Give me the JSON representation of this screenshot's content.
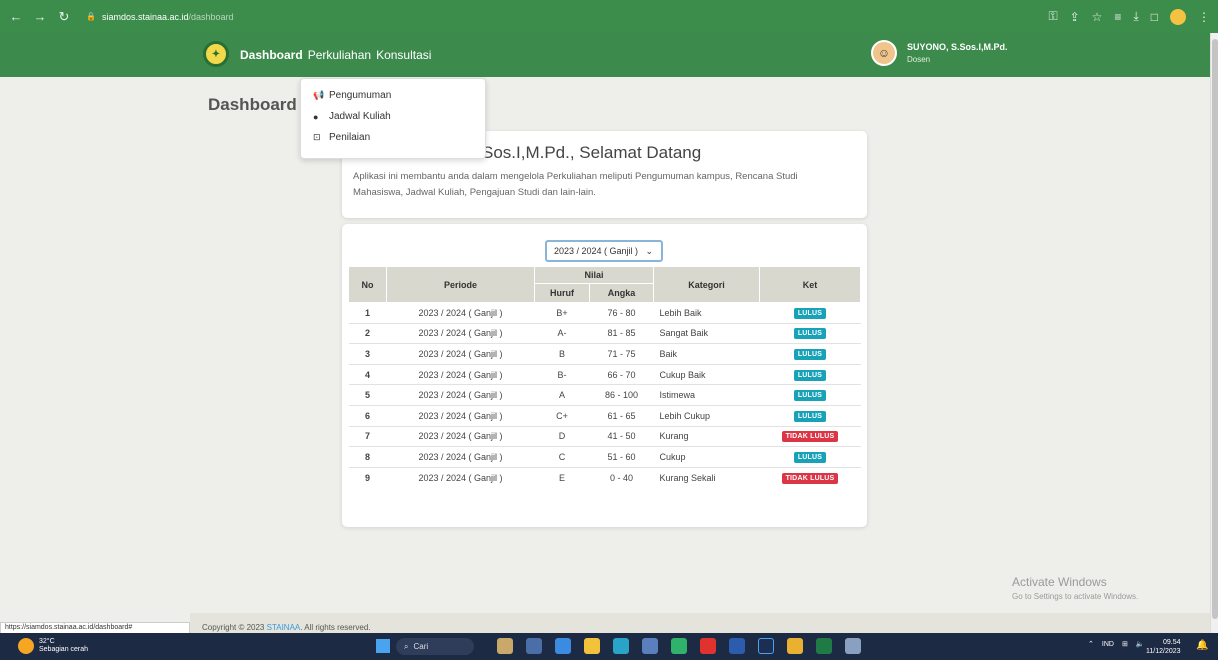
{
  "browser": {
    "url_host": "siamdos.stainaa.ac.id",
    "url_path": "/dashboard"
  },
  "nav": {
    "items": [
      "Dashboard",
      "Perkuliahan",
      "Konsultasi"
    ],
    "user_name": "SUYONO, S.Sos.I,M.Pd.",
    "user_role": "Dosen"
  },
  "page_title": "Dashboard",
  "dropdown": {
    "items": [
      "Pengumuman",
      "Jadwal Kuliah",
      "Penilaian"
    ]
  },
  "welcome": {
    "title": "Sos.I,M.Pd., Selamat Datang",
    "description": "Aplikasi ini membantu anda dalam mengelola Perkuliahan meliputi Pengumuman kampus, Rencana Studi Mahasiswa, Jadwal Kuliah, Pengajuan Studi dan lain-lain."
  },
  "grades": {
    "selected_period": "2023 / 2024 ( Ganjil )",
    "headers": {
      "no": "No",
      "periode": "Periode",
      "nilai": "Nilai",
      "huruf": "Huruf",
      "angka": "Angka",
      "kategori": "Kategori",
      "ket": "Ket"
    },
    "rows": [
      {
        "no": "1",
        "periode": "2023 / 2024 ( Ganjil )",
        "huruf": "B+",
        "angka": "76 - 80",
        "kategori": "Lebih Baik",
        "ket": "LULUS"
      },
      {
        "no": "2",
        "periode": "2023 / 2024 ( Ganjil )",
        "huruf": "A-",
        "angka": "81 - 85",
        "kategori": "Sangat Baik",
        "ket": "LULUS"
      },
      {
        "no": "3",
        "periode": "2023 / 2024 ( Ganjil )",
        "huruf": "B",
        "angka": "71 - 75",
        "kategori": "Baik",
        "ket": "LULUS"
      },
      {
        "no": "4",
        "periode": "2023 / 2024 ( Ganjil )",
        "huruf": "B-",
        "angka": "66 - 70",
        "kategori": "Cukup Baik",
        "ket": "LULUS"
      },
      {
        "no": "5",
        "periode": "2023 / 2024 ( Ganjil )",
        "huruf": "A",
        "angka": "86 - 100",
        "kategori": "Istimewa",
        "ket": "LULUS"
      },
      {
        "no": "6",
        "periode": "2023 / 2024 ( Ganjil )",
        "huruf": "C+",
        "angka": "61 - 65",
        "kategori": "Lebih Cukup",
        "ket": "LULUS"
      },
      {
        "no": "7",
        "periode": "2023 / 2024 ( Ganjil )",
        "huruf": "D",
        "angka": "41 - 50",
        "kategori": "Kurang",
        "ket": "TIDAK LULUS"
      },
      {
        "no": "8",
        "periode": "2023 / 2024 ( Ganjil )",
        "huruf": "C",
        "angka": "51 - 60",
        "kategori": "Cukup",
        "ket": "LULUS"
      },
      {
        "no": "9",
        "periode": "2023 / 2024 ( Ganjil )",
        "huruf": "E",
        "angka": "0 - 40",
        "kategori": "Kurang Sekali",
        "ket": "TIDAK LULUS"
      }
    ]
  },
  "footer": {
    "copyright_prefix": "Copyright © 2023",
    "brand": "STAINAA",
    "copyright_suffix": ". All rights reserved.",
    "status_url": "https://siamdos.stainaa.ac.id/dashboard#"
  },
  "watermark": {
    "line1": "Activate Windows",
    "line2": "Go to Settings to activate Windows."
  },
  "taskbar": {
    "temp": "32°C",
    "weather": "Sebagian cerah",
    "search": "Cari",
    "lang": "IND",
    "time": "09.54",
    "date": "11/12/2023"
  },
  "colors": {
    "nav_green": "#3d8b4c",
    "badge_lulus": "#17a2b8",
    "badge_tidak": "#dc3545"
  }
}
